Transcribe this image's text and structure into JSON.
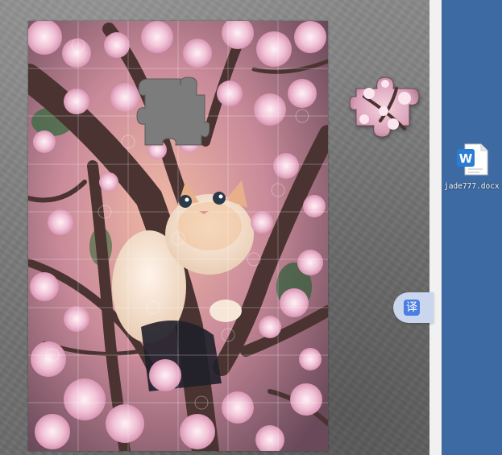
{
  "game": {
    "board": {
      "grid_cols": 6,
      "grid_rows": 9
    },
    "loose_piece": {
      "description": "puzzle-piece"
    },
    "translate_button": {
      "label": "译"
    }
  },
  "desktop": {
    "file": {
      "name": "jade777.docx",
      "badge": "W",
      "icon": "word-document-icon"
    }
  },
  "colors": {
    "desktop_bg": "#3d6aa3",
    "game_bg": "#7a7a7a",
    "blossom": "#e8b4cf",
    "word_blue": "#2b7cd3",
    "translate_bg": "#c9d6ee"
  }
}
